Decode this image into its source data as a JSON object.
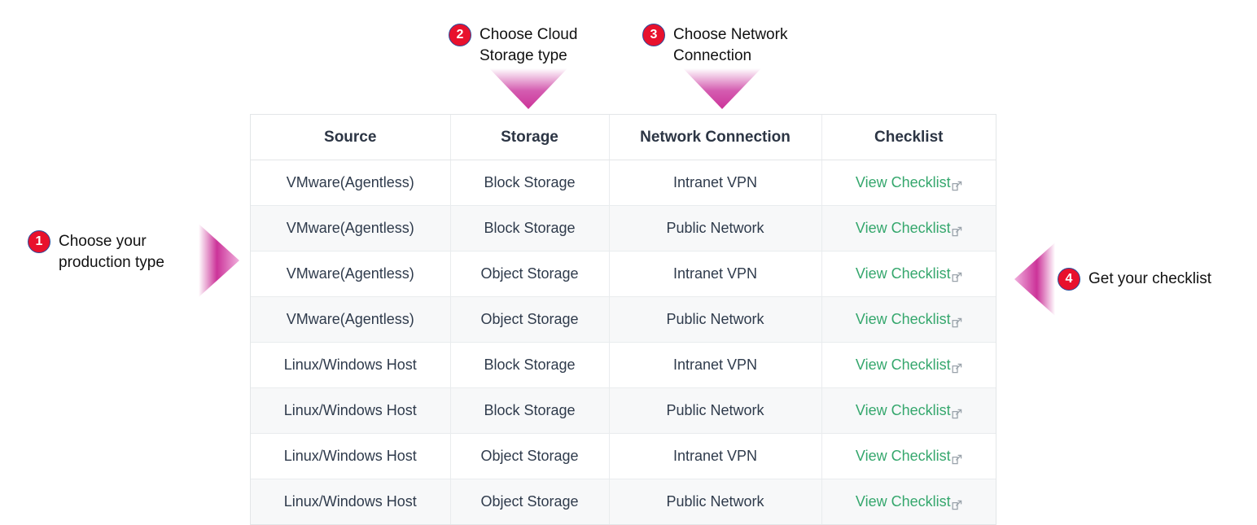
{
  "steps": [
    {
      "number": "1",
      "label": "Choose your\nproduction type"
    },
    {
      "number": "2",
      "label": "Choose Cloud\nStorage type"
    },
    {
      "number": "3",
      "label": "Choose Network\nConnection"
    },
    {
      "number": "4",
      "label": "Get your checklist"
    }
  ],
  "arrows": {
    "step1_direction": "right",
    "step2_direction": "down",
    "step3_direction": "down",
    "step4_direction": "left",
    "color": "#cc3399"
  },
  "colors": {
    "badge_red": "#e8112d",
    "badge_outline": "#2a4b9b",
    "arrow_magenta": "#cc3399",
    "link_green": "#35a76d",
    "header_text": "#2c3544",
    "cell_text": "#2f3b4c",
    "row_alt_bg": "#f7f8f9",
    "border": "#e9ecee"
  },
  "table": {
    "headers": [
      "Source",
      "Storage",
      "Network Connection",
      "Checklist"
    ],
    "link_icon": "external-link-icon",
    "rows": [
      {
        "source": "VMware(Agentless)",
        "storage": "Block Storage",
        "network": "Intranet VPN",
        "checklist": "View Checklist"
      },
      {
        "source": "VMware(Agentless)",
        "storage": "Block Storage",
        "network": "Public Network",
        "checklist": "View Checklist"
      },
      {
        "source": "VMware(Agentless)",
        "storage": "Object Storage",
        "network": "Intranet VPN",
        "checklist": "View Checklist"
      },
      {
        "source": "VMware(Agentless)",
        "storage": "Object Storage",
        "network": "Public Network",
        "checklist": "View Checklist"
      },
      {
        "source": "Linux/Windows Host",
        "storage": "Block Storage",
        "network": "Intranet VPN",
        "checklist": "View Checklist"
      },
      {
        "source": "Linux/Windows Host",
        "storage": "Block Storage",
        "network": "Public Network",
        "checklist": "View Checklist"
      },
      {
        "source": "Linux/Windows Host",
        "storage": "Object Storage",
        "network": "Intranet VPN",
        "checklist": "View Checklist"
      },
      {
        "source": "Linux/Windows Host",
        "storage": "Object Storage",
        "network": "Public Network",
        "checklist": "View Checklist"
      }
    ]
  }
}
